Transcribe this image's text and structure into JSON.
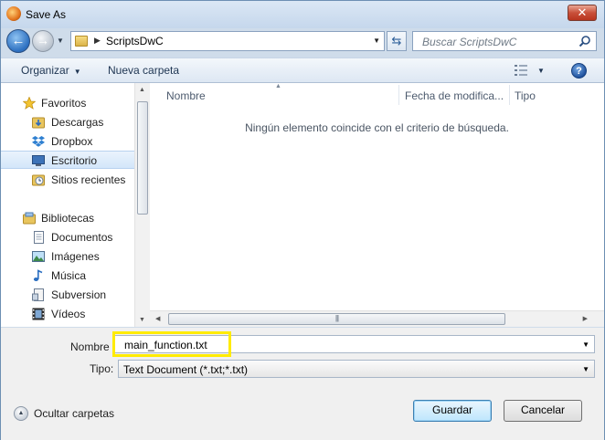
{
  "window": {
    "title": "Save As",
    "close_label": "✕"
  },
  "navigation": {
    "back_icon": "back-arrow-icon",
    "forward_icon": "forward-arrow-icon",
    "breadcrumb": [
      "ScriptsDwC"
    ],
    "search_placeholder": "Buscar ScriptsDwC"
  },
  "toolbar": {
    "organize_label": "Organizar",
    "new_folder_label": "Nueva carpeta",
    "help_label": "?"
  },
  "sidebar": {
    "groups": [
      {
        "label": "Favoritos",
        "icon": "star-icon"
      },
      {
        "label": "Bibliotecas",
        "icon": "libraries-icon"
      }
    ],
    "favorites": [
      {
        "label": "Descargas",
        "icon": "downloads-folder-icon"
      },
      {
        "label": "Dropbox",
        "icon": "dropbox-icon"
      },
      {
        "label": "Escritorio",
        "icon": "desktop-icon",
        "selected": true
      },
      {
        "label": "Sitios recientes",
        "icon": "recent-places-icon"
      }
    ],
    "libraries": [
      {
        "label": "Documentos",
        "icon": "documents-icon"
      },
      {
        "label": "Imágenes",
        "icon": "pictures-icon"
      },
      {
        "label": "Música",
        "icon": "music-icon"
      },
      {
        "label": "Subversion",
        "icon": "subversion-icon"
      },
      {
        "label": "Vídeos",
        "icon": "videos-icon"
      }
    ]
  },
  "file_list": {
    "columns": [
      "Nombre",
      "Fecha de modifica...",
      "Tipo"
    ],
    "empty_message": "Ningún elemento coincide con el criterio de búsqueda."
  },
  "form": {
    "name_label": "Nombre",
    "name_value": "main_function.txt",
    "type_label": "Tipo:",
    "type_value": "Text Document (*.txt;*.txt)"
  },
  "footer": {
    "hide_folders_label": "Ocultar carpetas",
    "save_label": "Guardar",
    "cancel_label": "Cancelar"
  },
  "colors": {
    "frame": "#cfdcea",
    "highlight": "#ffeb00",
    "selection": "#d3e6fa"
  }
}
